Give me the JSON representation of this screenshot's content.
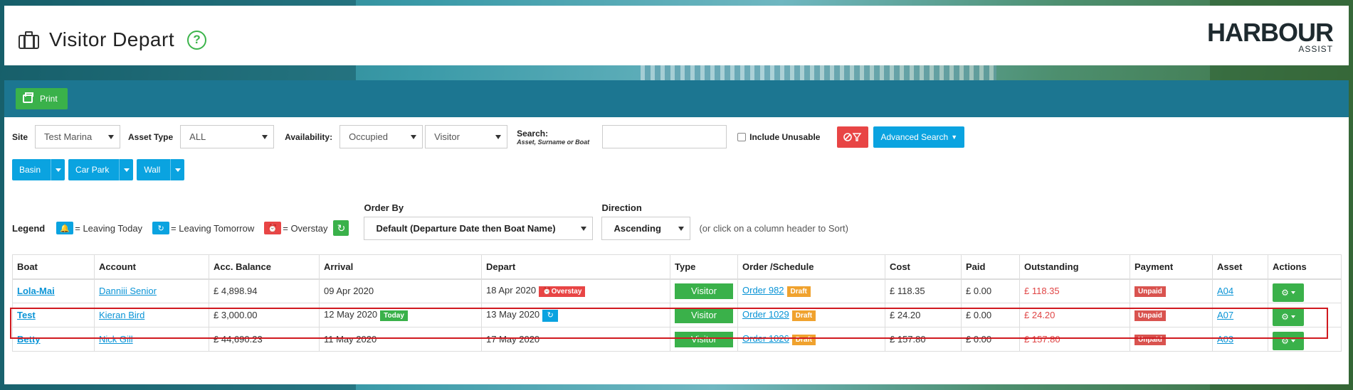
{
  "header": {
    "title": "Visitor Depart",
    "help_icon": "?",
    "logo_main": "HARBOUR",
    "logo_sub": "ASSIST"
  },
  "toolbar": {
    "print_label": "Print"
  },
  "filters": {
    "site_label": "Site",
    "site_value": "Test Marina",
    "asset_type_label": "Asset Type",
    "asset_type_value": "ALL",
    "availability_label": "Availability:",
    "availability_value": "Occupied",
    "availability_value2": "Visitor",
    "search_label": "Search:",
    "search_hint": "Asset, Surname or Boat",
    "search_value": "",
    "include_unusable_label": "Include Unusable",
    "advanced_search_label": "Advanced Search"
  },
  "chips": [
    {
      "label": "Basin"
    },
    {
      "label": "Car Park"
    },
    {
      "label": "Wall"
    }
  ],
  "legend": {
    "title": "Legend",
    "leaving_today": "= Leaving Today",
    "leaving_tomorrow": "= Leaving Tomorrow",
    "overstay": "= Overstay"
  },
  "order": {
    "order_by_label": "Order By",
    "order_by_value": "Default (Departure Date then Boat Name)",
    "direction_label": "Direction",
    "direction_value": "Ascending",
    "hint": "(or click on a column header to Sort)"
  },
  "table": {
    "headers": [
      "Boat",
      "Account",
      "Acc. Balance",
      "Arrival",
      "Depart",
      "Type",
      "Order /Schedule",
      "Cost",
      "Paid",
      "Outstanding",
      "Payment",
      "Asset",
      "Actions"
    ],
    "rows": [
      {
        "boat": "Lola-Mai",
        "account": "Danniii Senior",
        "balance": "£ 4,898.94",
        "arrival": "09 Apr 2020",
        "arrival_badge": "",
        "depart": "18 Apr 2020",
        "depart_badge": "Overstay",
        "type": "Visitor",
        "order": "Order 982",
        "order_badge": "Draft",
        "cost": "£ 118.35",
        "paid": "£ 0.00",
        "outstanding": "£ 118.35",
        "payment": "Unpaid",
        "asset": "A04"
      },
      {
        "boat": "Test",
        "account": "Kieran Bird",
        "balance": "£ 3,000.00",
        "arrival": "12 May 2020",
        "arrival_badge": "Today",
        "depart": "13 May 2020",
        "depart_badge": "",
        "type": "Visitor",
        "order": "Order 1029",
        "order_badge": "Draft",
        "cost": "£ 24.20",
        "paid": "£ 0.00",
        "outstanding": "£ 24.20",
        "payment": "Unpaid",
        "asset": "A07"
      },
      {
        "boat": "Betty",
        "account": "Nick Gill",
        "balance": "£ 44,690.23",
        "arrival": "11 May 2020",
        "arrival_badge": "",
        "depart": "17 May 2020",
        "depart_badge": "",
        "type": "Visitor",
        "order": "Order 1026",
        "order_badge": "Draft",
        "cost": "£ 157.80",
        "paid": "£ 0.00",
        "outstanding": "£ 157.80",
        "payment": "Unpaid",
        "asset": "A03"
      }
    ]
  },
  "colors": {
    "accent_green": "#3ab14a",
    "accent_blue": "#0aa3e0",
    "teal_bar": "#1c7691",
    "danger_red": "#e84545",
    "draft_orange": "#f0a22e",
    "highlight_red": "#d0191f"
  },
  "icons": {
    "title_icon": "briefcase-icon",
    "leaving_today_icon": "bell-icon",
    "leaving_tomorrow_icon": "redo-icon",
    "overstay_icon": "alarm-clock-icon",
    "refresh_icon": "refresh-icon",
    "action_icon": "gear-icon",
    "clear_filter_icon": "filter-clear-icon"
  }
}
